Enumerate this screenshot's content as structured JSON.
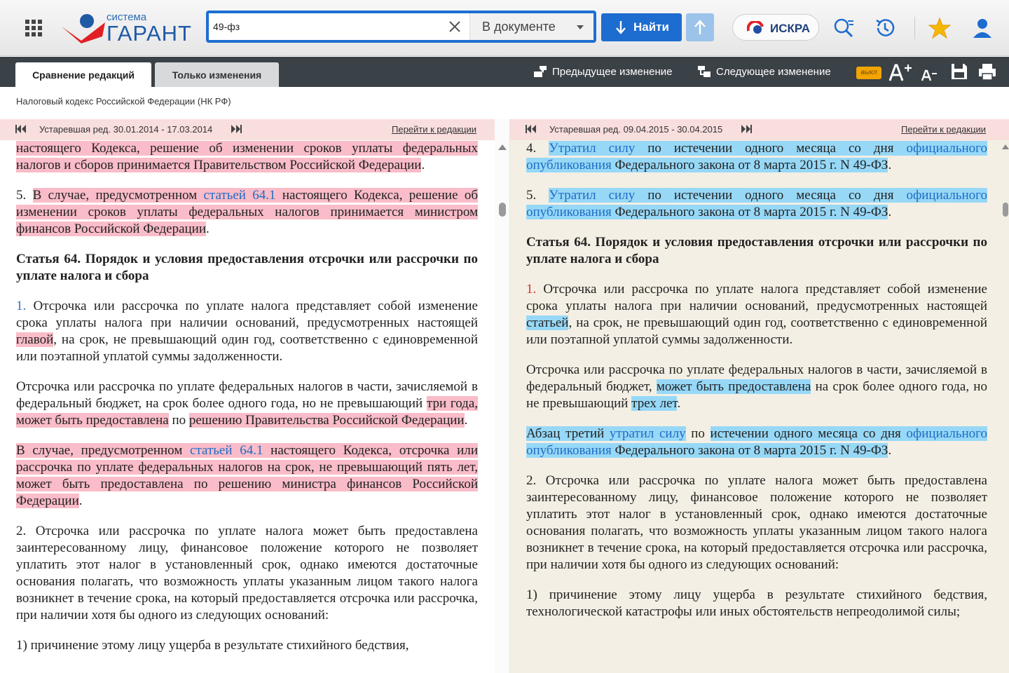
{
  "header": {
    "logo_top": "система",
    "logo_brand": "ГАРАНТ",
    "search_value": "49-фз",
    "search_scope": "В документе",
    "find_label": "Найти",
    "iskra_label": "ИСКРА"
  },
  "toolbar": {
    "tab_compare": "Сравнение редакций",
    "tab_changes": "Только изменения",
    "prev_change": "Предыдущее изменение",
    "next_change": "Следующее изменение",
    "off_badge": "выкл"
  },
  "document": {
    "title": "Налоговый кодекс Российской Федерации (НК РФ)"
  },
  "left": {
    "edition": "Устаревшая ред. 30.01.2014 - 17.03.2014",
    "goto": "Перейти к редакции",
    "p0": "настоящего Кодекса, решение об изменении сроков уплаты федеральных налогов и сборов принимается Правительством Российской Федерации",
    "p1_num": "5. ",
    "p1_a": "В случае, предусмотренном ",
    "p1_link": "статьей 64.1",
    "p1_b": " настоящего Кодекса, решение об изменении сроков уплаты федеральных налогов принимается министром финансов Российской Федерации",
    "h1": "Статья 64. Порядок и условия предоставления отсрочки или рассрочки по уплате налога и сбора",
    "p2_num": "1.",
    "p2_a": " Отсрочка или рассрочка по уплате налога представляет собой изменение срока уплаты налога при наличии оснований, предусмотренных настоящей ",
    "p2_del": "главой",
    "p2_b": ", на срок, не превышающий один год, соответственно с единовременной или поэтапной уплатой суммы задолженности.",
    "p3_a": "Отсрочка или рассрочка по уплате федеральных налогов в части, зачисляемой в федеральный бюджет, на срок более одного года, но не превышающий ",
    "p3_del1": "три года, может быть предоставлена",
    "p3_b": " по ",
    "p3_del2": "решению Правительства Российской Федерации",
    "p4_a": "В случае, предусмотренном ",
    "p4_link": "статьей 64.1",
    "p4_b": " настоящего Кодекса, отсрочка или рассрочка по уплате федеральных налогов на срок, не превышающий пять лет, может быть предоставлена по решению министра финансов Российской Федерации",
    "p5": "2. Отсрочка или рассрочка по уплате налога может быть предоставлена заинтересованному лицу, финансовое положение которого не позволяет уплатить этот налог в установленный срок, однако имеются достаточные основания полагать, что возможность уплаты указанным лицом такого налога возникнет в течение срока, на который предоставляется отсрочка или рассрочка, при наличии хотя бы одного из следующих оснований:",
    "p6": "1) причинение этому лицу ущерба в результате стихийного бедствия,"
  },
  "right": {
    "edition": "Устаревшая ред. 09.04.2015 - 30.04.2015",
    "goto": "Перейти к редакции",
    "p0_num": "4. ",
    "p0_link1": "Утратил силу",
    "p0_a": " по истечении одного месяца со дня ",
    "p0_link2": "официального опубликования",
    "p0_b": " Федерального закона от 8 марта 2015 г. N 49-ФЗ",
    "p1_num": "5. ",
    "p1_link1": "Утратил силу",
    "p1_a": " по истечении одного месяца со дня ",
    "p1_link2": "официального опубликования",
    "p1_b": " Федерального закона от 8 марта 2015 г. N 49-ФЗ",
    "h1": "Статья 64. Порядок и условия предоставления отсрочки или рассрочки по уплате налога и сбора",
    "p2_num": "1.",
    "p2_a": " Отсрочка или рассрочка по уплате налога представляет собой изменение срока уплаты налога при наличии оснований, предусмотренных настоящей ",
    "p2_ins": "статьей",
    "p2_b": ", на срок, не превышающий один год, соответственно с единовременной или поэтапной уплатой суммы задолженности.",
    "p3_a": "Отсрочка или рассрочка по уплате федеральных налогов в части, зачисляемой в федеральный бюджет, ",
    "p3_ins1": "может быть предоставлена",
    "p3_b": " на срок более одного года, но не превышающий ",
    "p3_ins2": "трех лет",
    "p4_a": "Абзац третий ",
    "p4_link1": "утратил силу",
    "p4_b": " по ",
    "p4_c": "истечении одного месяца со дня ",
    "p4_link2": "официального опубликования",
    "p4_d": " Федерального закона от 8 марта 2015 г. N 49-ФЗ",
    "p5": "2. Отсрочка или рассрочка по уплате налога может быть предоставлена заинтересованному лицу, финансовое положение которого не позволяет уплатить этот налог в установленный срок, однако имеются достаточные основания полагать, что возможность уплаты указанным лицом такого налога возникнет в течение срока, на который предоставляется отсрочка или рассрочка, при наличии хотя бы одного из следующих оснований:",
    "p6": "1) причинение этому лицу ущерба в результате стихийного бедствия, технологической катастрофы или иных обстоятельств непреодолимой силы;"
  },
  "colors": {
    "accent": "#1c6fd1",
    "deleted": "#f9bcc8",
    "inserted": "#97d8f7",
    "toolbar": "#3a4147"
  },
  "icons": [
    "apps-grid-icon",
    "garant-logo-icon",
    "clear-icon",
    "arrow-down-icon",
    "arrow-up-icon",
    "iskra-icon",
    "smart-search-icon",
    "history-icon",
    "star-icon",
    "user-icon",
    "prev-change-icon",
    "next-change-icon",
    "font-increase-icon",
    "font-decrease-icon",
    "save-icon",
    "print-icon",
    "first-page-icon",
    "last-page-icon"
  ]
}
